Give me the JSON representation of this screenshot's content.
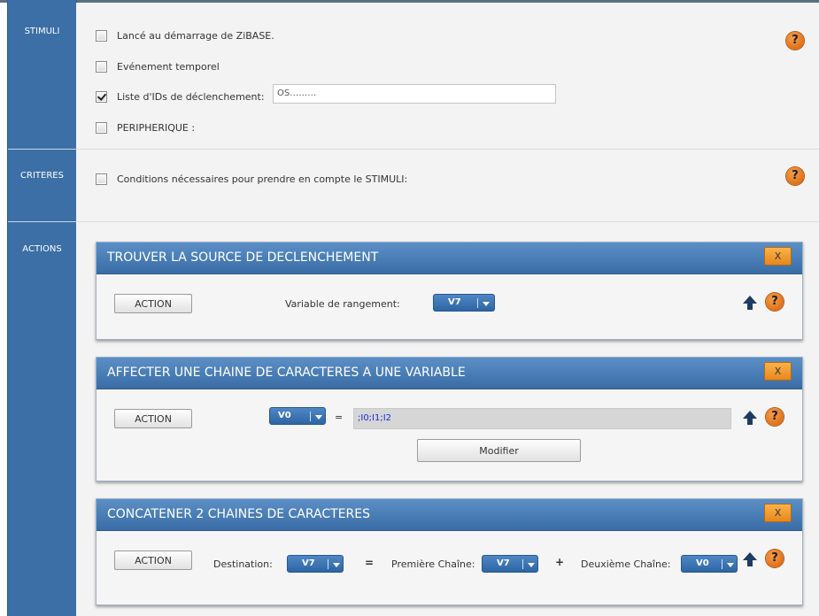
{
  "sidebar": {
    "stimuli_label": "STIMULI",
    "criteres_label": "CRITERES",
    "actions_label": "ACTIONS"
  },
  "stimuli": {
    "items": [
      {
        "label": "Lancé au démarrage de ZiBASE.",
        "checked": false
      },
      {
        "label": "Evénement temporel",
        "checked": false
      },
      {
        "label": "Liste d'IDs de déclenchement:",
        "checked": true
      },
      {
        "label": "PERIPHERIQUE :",
        "checked": false
      }
    ],
    "ids_value": "OS………"
  },
  "criteres": {
    "label": "Conditions nécessaires pour prendre en compte le STIMULI:"
  },
  "help_icon_text": "?",
  "close_label": "X",
  "action_label": "ACTION",
  "actions": {
    "panel1": {
      "title": "TROUVER LA SOURCE DE DECLENCHEMENT",
      "var_label": "Variable de rangement:",
      "var_value": "V7"
    },
    "panel2": {
      "title": "AFFECTER UNE CHAINE DE CARACTERES A UNE VARIABLE",
      "var_value": "V0",
      "equals": "=",
      "string_value": ";I0;I1;I2",
      "modify_label": "Modifier"
    },
    "panel3": {
      "title": "CONCATENER 2 CHAINES DE CARACTERES",
      "dest_label": "Destination:",
      "dest_value": "V7",
      "equals": "=",
      "first_label": "Première Chaîne:",
      "first_value": "V7",
      "plus": "+",
      "second_label": "Deuxième Chaîne:",
      "second_value": "V0"
    }
  },
  "colors": {
    "sidebar": "#3b6fa5",
    "panel_header": "#4a7eb6",
    "help": "#e0701a",
    "close_button": "#f0a030",
    "select": "#3a72b2"
  }
}
